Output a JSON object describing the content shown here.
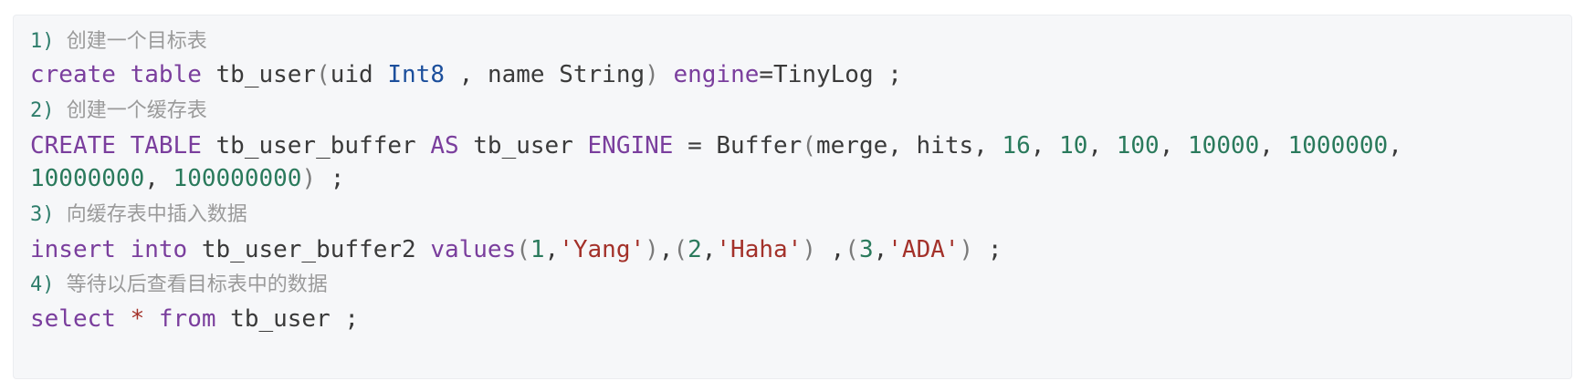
{
  "colors": {
    "background": "#f6f7f9",
    "keyword": "#7a3e9d",
    "type": "#1c4f9c",
    "number": "#2a7a5c",
    "string": "#a3312a",
    "plain": "#3a3a3a",
    "comment": "#9a9a9a"
  },
  "lines": [
    {
      "kind": "comment",
      "tokens": [
        {
          "t": "1)",
          "c": "num"
        },
        {
          "t": " ",
          "c": "pl"
        },
        {
          "t": "创建一个目标表",
          "c": "cjk"
        }
      ]
    },
    {
      "kind": "code",
      "tokens": [
        {
          "t": "create",
          "c": "kw"
        },
        {
          "t": " ",
          "c": "pl"
        },
        {
          "t": "table",
          "c": "kw"
        },
        {
          "t": " tb_user",
          "c": "pl"
        },
        {
          "t": "(",
          "c": "pn"
        },
        {
          "t": "uid ",
          "c": "pl"
        },
        {
          "t": "Int8",
          "c": "ty"
        },
        {
          "t": " , name String",
          "c": "pl"
        },
        {
          "t": ")",
          "c": "pn"
        },
        {
          "t": " ",
          "c": "pl"
        },
        {
          "t": "engine",
          "c": "kw"
        },
        {
          "t": "=TinyLog ;",
          "c": "pl"
        }
      ]
    },
    {
      "kind": "comment",
      "tokens": [
        {
          "t": "2)",
          "c": "num"
        },
        {
          "t": " ",
          "c": "pl"
        },
        {
          "t": "创建一个缓存表",
          "c": "cjk"
        }
      ]
    },
    {
      "kind": "code",
      "tokens": [
        {
          "t": "CREATE",
          "c": "kw"
        },
        {
          "t": " ",
          "c": "pl"
        },
        {
          "t": "TABLE",
          "c": "kw"
        },
        {
          "t": " tb_user_buffer ",
          "c": "pl"
        },
        {
          "t": "AS",
          "c": "kw"
        },
        {
          "t": " tb_user ",
          "c": "pl"
        },
        {
          "t": "ENGINE",
          "c": "kw"
        },
        {
          "t": " = Buffer",
          "c": "pl"
        },
        {
          "t": "(",
          "c": "pn"
        },
        {
          "t": "merge, hits, ",
          "c": "pl"
        },
        {
          "t": "16",
          "c": "nm"
        },
        {
          "t": ", ",
          "c": "pl"
        },
        {
          "t": "10",
          "c": "nm"
        },
        {
          "t": ", ",
          "c": "pl"
        },
        {
          "t": "100",
          "c": "nm"
        },
        {
          "t": ", ",
          "c": "pl"
        },
        {
          "t": "10000",
          "c": "nm"
        },
        {
          "t": ", ",
          "c": "pl"
        },
        {
          "t": "1000000",
          "c": "nm"
        },
        {
          "t": ",",
          "c": "pl"
        }
      ]
    },
    {
      "kind": "code",
      "tokens": [
        {
          "t": "10000000",
          "c": "nm"
        },
        {
          "t": ", ",
          "c": "pl"
        },
        {
          "t": "100000000",
          "c": "nm"
        },
        {
          "t": ")",
          "c": "pn"
        },
        {
          "t": " ;",
          "c": "pl"
        }
      ]
    },
    {
      "kind": "comment",
      "tokens": [
        {
          "t": "3)",
          "c": "num"
        },
        {
          "t": " ",
          "c": "pl"
        },
        {
          "t": "向缓存表中插入数据",
          "c": "cjk"
        }
      ]
    },
    {
      "kind": "code",
      "tokens": [
        {
          "t": "insert",
          "c": "kw"
        },
        {
          "t": " ",
          "c": "pl"
        },
        {
          "t": "into",
          "c": "kw"
        },
        {
          "t": " tb_user_buffer2 ",
          "c": "pl"
        },
        {
          "t": "values",
          "c": "kw"
        },
        {
          "t": "(",
          "c": "pn"
        },
        {
          "t": "1",
          "c": "nm"
        },
        {
          "t": ",",
          "c": "pl"
        },
        {
          "t": "'Yang'",
          "c": "st"
        },
        {
          "t": ")",
          "c": "pn"
        },
        {
          "t": ",",
          "c": "pl"
        },
        {
          "t": "(",
          "c": "pn"
        },
        {
          "t": "2",
          "c": "nm"
        },
        {
          "t": ",",
          "c": "pl"
        },
        {
          "t": "'Haha'",
          "c": "st"
        },
        {
          "t": ")",
          "c": "pn"
        },
        {
          "t": " ,",
          "c": "pl"
        },
        {
          "t": "(",
          "c": "pn"
        },
        {
          "t": "3",
          "c": "nm"
        },
        {
          "t": ",",
          "c": "pl"
        },
        {
          "t": "'ADA'",
          "c": "st"
        },
        {
          "t": ")",
          "c": "pn"
        },
        {
          "t": " ;",
          "c": "pl"
        }
      ]
    },
    {
      "kind": "comment",
      "tokens": [
        {
          "t": "4)",
          "c": "num"
        },
        {
          "t": " ",
          "c": "pl"
        },
        {
          "t": "等待以后查看目标表中的数据",
          "c": "cjk"
        }
      ]
    },
    {
      "kind": "code",
      "tokens": [
        {
          "t": "select",
          "c": "kw"
        },
        {
          "t": " ",
          "c": "pl"
        },
        {
          "t": "*",
          "c": "st"
        },
        {
          "t": " ",
          "c": "pl"
        },
        {
          "t": "from",
          "c": "kw"
        },
        {
          "t": " tb_user ;",
          "c": "pl"
        }
      ]
    }
  ]
}
